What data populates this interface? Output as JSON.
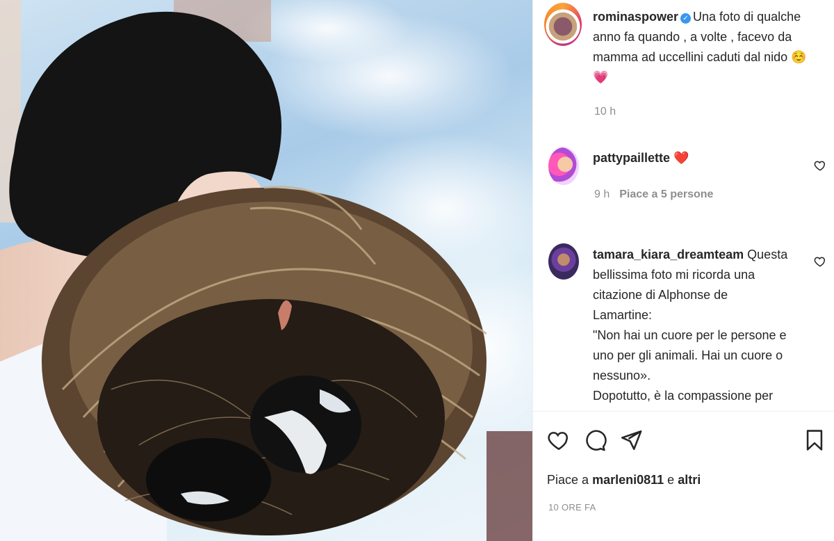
{
  "post": {
    "author": "rominaspower",
    "caption_lines": [
      "Una foto di qualche",
      "anno fa quando , a volte , facevo da",
      "mamma ad uccellini caduti dal nido ☺️",
      "💗"
    ],
    "time": "10 h"
  },
  "comments": [
    {
      "user": "pattypaillette",
      "text": "❤️",
      "time": "9 h",
      "likes": "Piace a 5 persone"
    },
    {
      "user": "tamara_kiara_dreamteam",
      "lines": [
        "Questa",
        "bellissima foto mi ricorda una",
        "citazione di Alphonse de",
        "Lamartine:",
        "\"Non hai un cuore per le persone e",
        "uno per gli animali. Hai un cuore o",
        "nessuno».",
        "Dopotutto, è la compassione per"
      ]
    }
  ],
  "footer": {
    "likes_prefix": "Piace a",
    "likes_user": "marleni0811",
    "likes_connector": "e",
    "likes_others": "altri",
    "time_ago": "10 ORE FA"
  },
  "icons": {
    "like": "heart-icon",
    "comment": "comment-icon",
    "share": "send-icon",
    "save": "bookmark-icon",
    "comment_like": "heart-icon",
    "verified": "verified-badge-icon"
  },
  "colors": {
    "text": "#262626",
    "muted": "#8e8e8e",
    "verified": "#3897f0",
    "heart": "#ed4956"
  }
}
